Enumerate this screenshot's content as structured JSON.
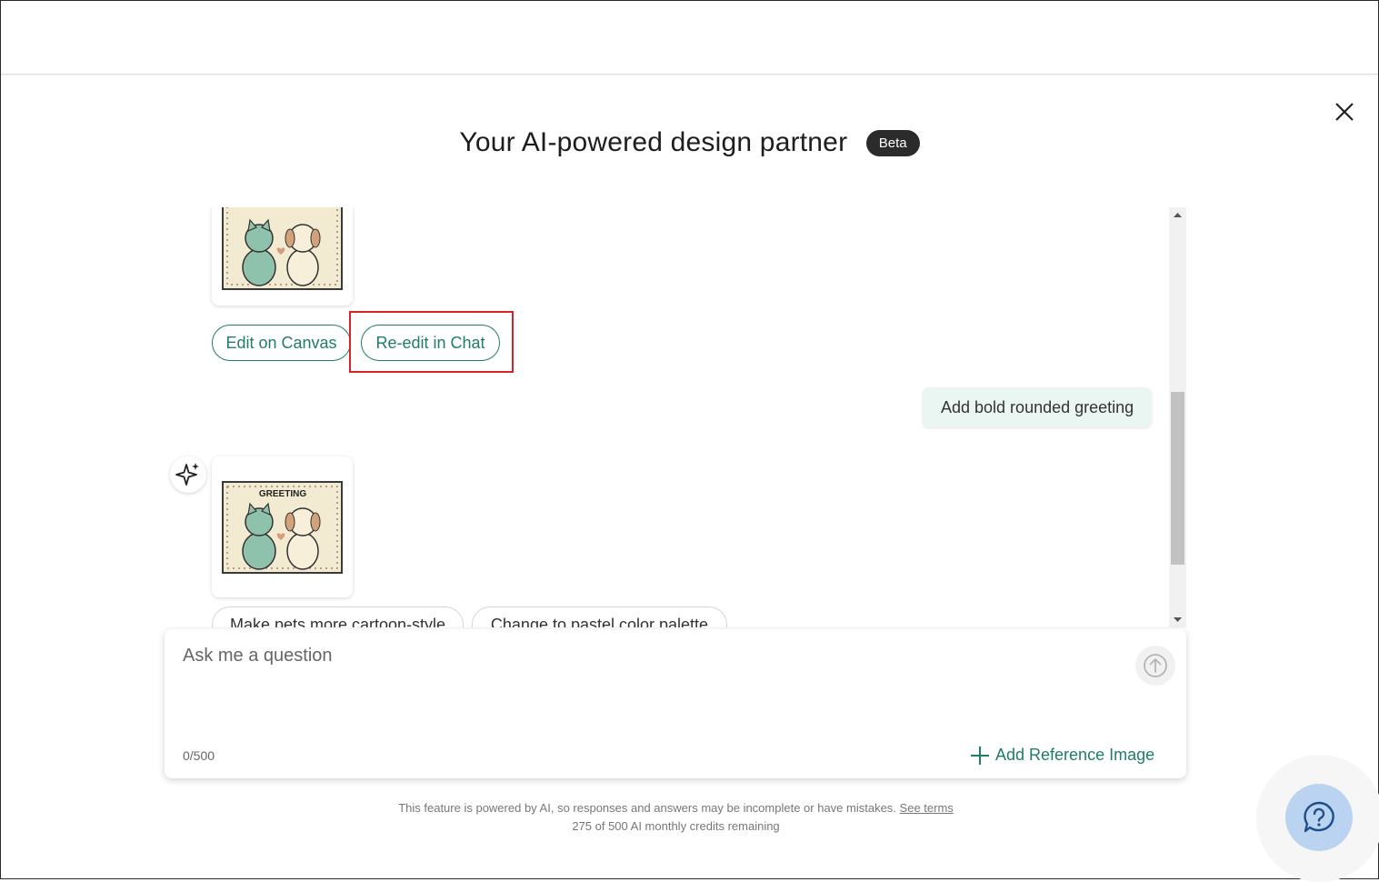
{
  "dialog": {
    "title": "Your AI-powered design partner",
    "badge": "Beta"
  },
  "chat": {
    "first_result": {
      "actions": [
        {
          "label": "Edit on Canvas"
        },
        {
          "label": "Re-edit in Chat"
        }
      ]
    },
    "user_message": "Add bold rounded greeting",
    "second_result": {
      "image_text": "GREETING",
      "suggestions": [
        {
          "label": "Make pets more cartoon-style"
        },
        {
          "label": "Change to pastel color palette"
        }
      ]
    }
  },
  "input": {
    "placeholder": "Ask me a question",
    "counter": "0/500",
    "add_reference_label": "Add Reference Image"
  },
  "footer": {
    "disclaimer": "This feature is powered by AI, so responses and answers may be incomplete or have mistakes.",
    "terms_link": "See terms",
    "credits": "275 of 500 AI monthly credits remaining"
  },
  "colors": {
    "accent": "#1f7d68",
    "highlight": "#d5232a",
    "user_bubble": "#eaf6f1",
    "help_button": "#b9d3f0"
  }
}
